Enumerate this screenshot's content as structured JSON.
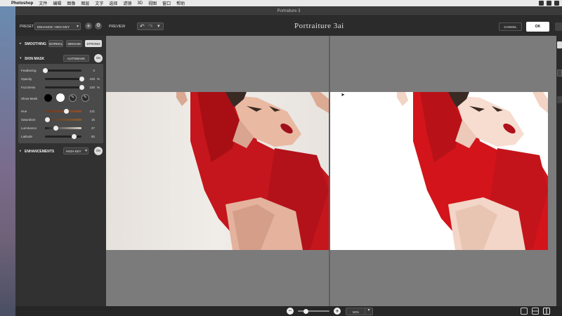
{
  "menubar": {
    "app": "Photoshop",
    "items": [
      "文件",
      "编辑",
      "图像",
      "图层",
      "文字",
      "选择",
      "滤镜",
      "3D",
      "视图",
      "窗口",
      "帮助"
    ]
  },
  "window": {
    "title": "Portraiture 3"
  },
  "toolbar": {
    "preset_label": "PRESET",
    "preset_value": "ENHANCE: HIGH KEY",
    "preview_label": "PREVIEW",
    "logo": "Portraiture 3ai",
    "cancel": "CANCEL",
    "ok": "OK"
  },
  "panel": {
    "smoothing": {
      "title": "SMOOTHING",
      "options": [
        "NORMAL",
        "MEDIUM",
        "STRONG"
      ],
      "selected": "STRONG"
    },
    "skin_mask": {
      "title": "SKIN MASK",
      "automask": "AUTOMASK OFF",
      "toggle": "On",
      "sliders": [
        {
          "label": "Feathering",
          "value": "0",
          "unit": "",
          "level": 0.0
        },
        {
          "label": "Opacity",
          "value": "100",
          "unit": "%",
          "level": 1.0
        },
        {
          "label": "Fuzziness",
          "value": "100",
          "unit": "%",
          "level": 1.0
        }
      ],
      "show_mask": "Show Mask",
      "color_sliders": [
        {
          "label": "Hue",
          "value": "121",
          "level": 0.58
        },
        {
          "label": "Saturation",
          "value": "16",
          "level": 0.06
        },
        {
          "label": "Luminance",
          "value": "27",
          "level": 0.3
        },
        {
          "label": "Latitude",
          "value": "82",
          "level": 0.8
        }
      ]
    },
    "enhancements": {
      "title": "ENHANCEMENTS",
      "preset": "HIGH KEY",
      "toggle": "On"
    }
  },
  "bottombar": {
    "zoom": "50%",
    "zoom_level": 0.25
  },
  "colors": {
    "accent_red": "#c4161c",
    "panel": "#313131",
    "preview_bg": "#7b7b7b"
  }
}
